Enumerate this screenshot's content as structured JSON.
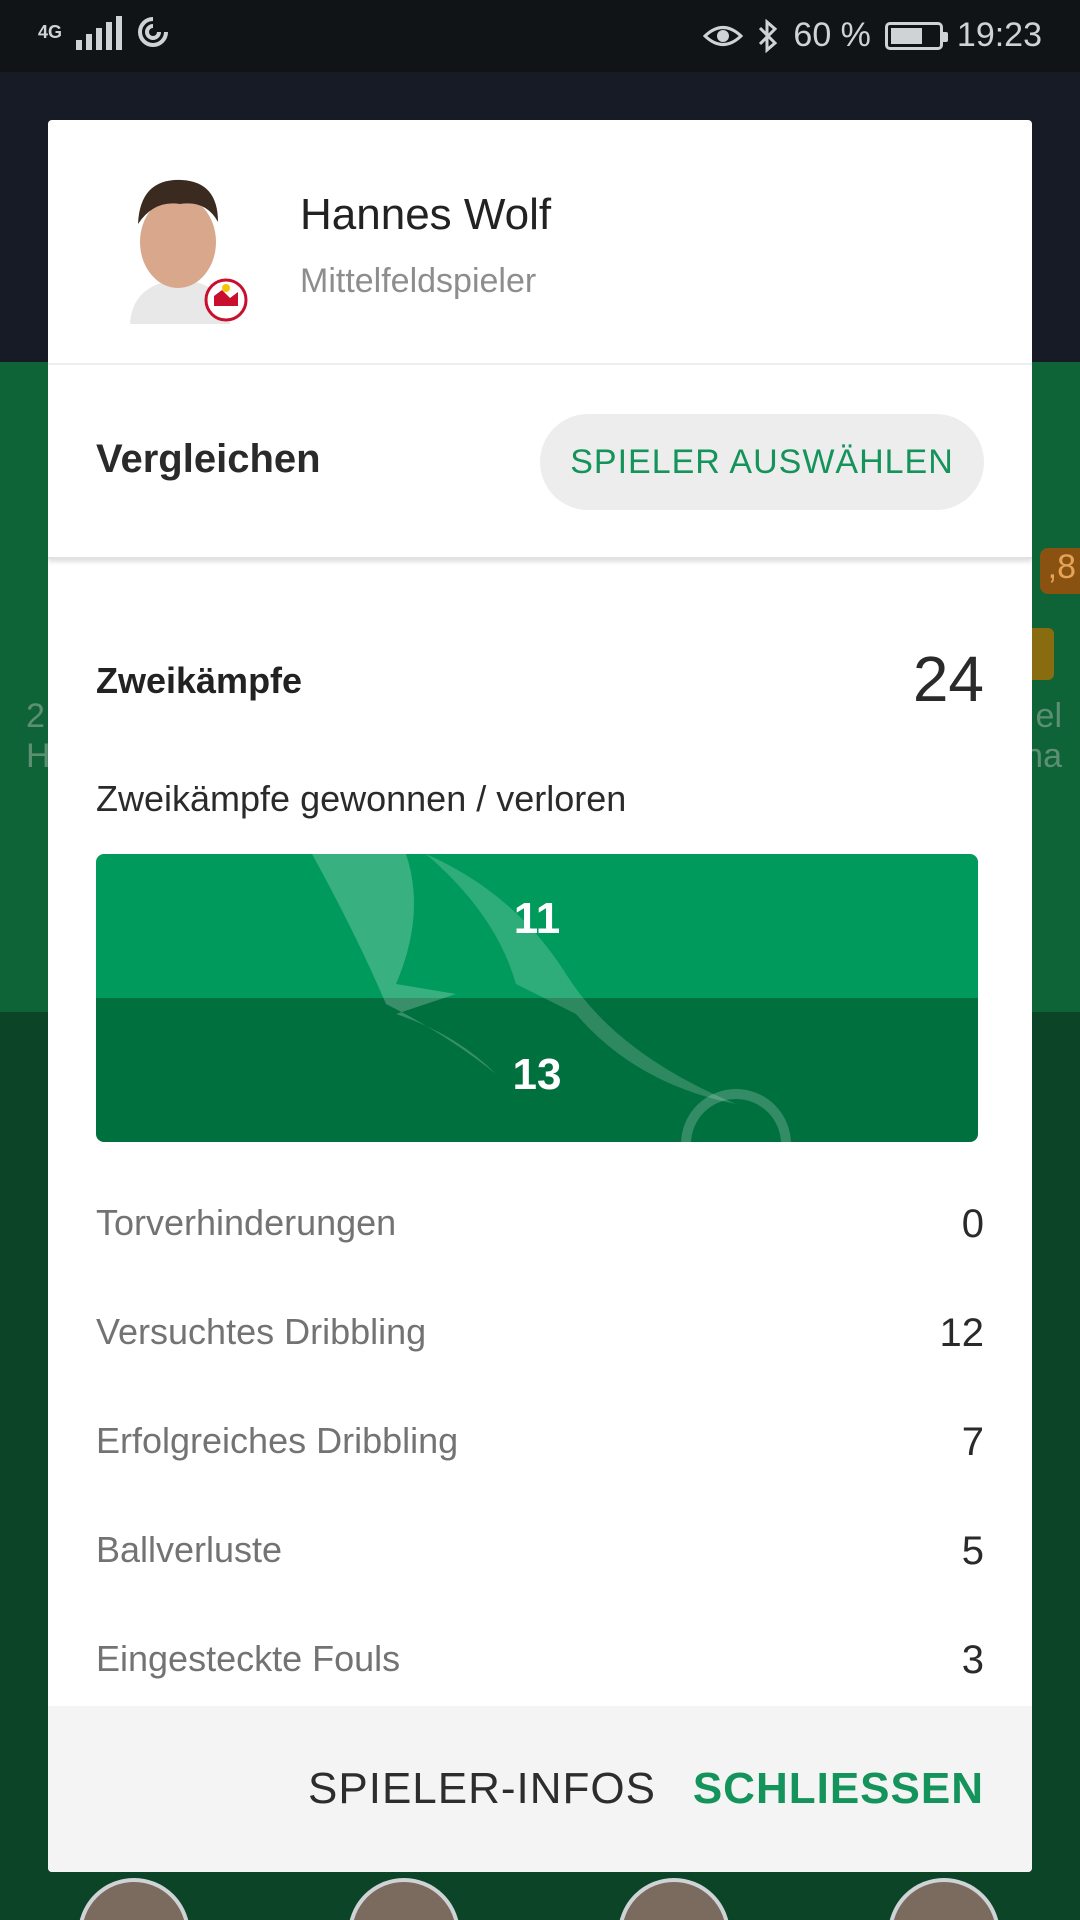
{
  "status_bar": {
    "network": "4G",
    "bluetooth": "bluetooth-icon",
    "battery_text": "60 %",
    "battery_level": 0.6,
    "time": "19:23"
  },
  "background": {
    "chip_value": ",8",
    "left_text_1": "2",
    "left_text_2": "H",
    "right_text_1": "el",
    "right_text_2": "na"
  },
  "player": {
    "name": "Hannes Wolf",
    "position": "Mittelfeldspieler"
  },
  "compare": {
    "label": "Vergleichen",
    "button": "SPIELER AUSWÄHLEN"
  },
  "duels": {
    "title": "Zweikämpfe",
    "total": "24",
    "subtitle": "Zweikämpfe gewonnen / verloren",
    "won": "11",
    "lost": "13"
  },
  "stats": [
    {
      "label": "Torverhinderungen",
      "value": "0"
    },
    {
      "label": "Versuchtes Dribbling",
      "value": "12"
    },
    {
      "label": "Erfolgreiches Dribbling",
      "value": "7"
    },
    {
      "label": "Ballverluste",
      "value": "5"
    },
    {
      "label": "Eingesteckte Fouls",
      "value": "3"
    }
  ],
  "footer": {
    "info_button": "SPIELER-INFOS",
    "close_button": "SCHLIESSEN"
  },
  "colors": {
    "accent": "#14935a",
    "won_bar": "#009a5c",
    "lost_bar": "#00703f"
  }
}
